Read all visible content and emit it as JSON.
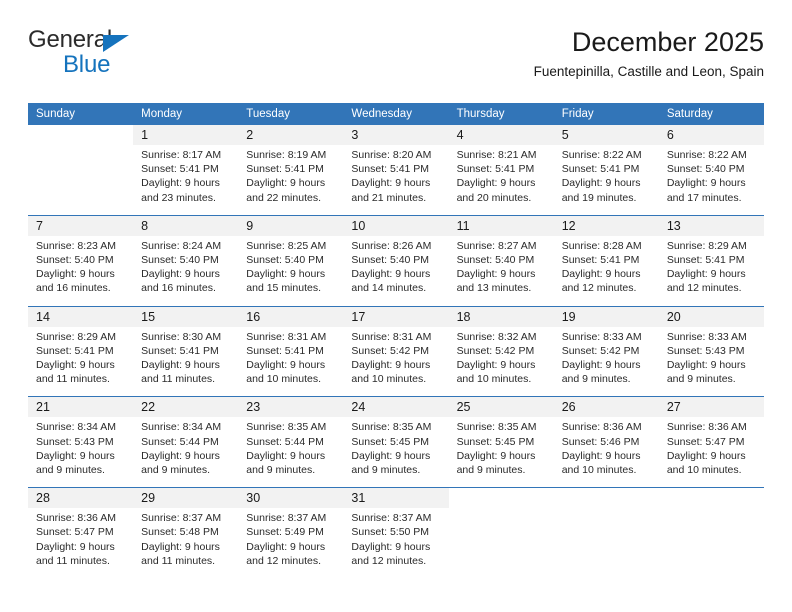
{
  "brand": {
    "name_top": "General",
    "name_bottom": "Blue",
    "triangle_color": "#1573bd",
    "text_color": "#2b2b2b"
  },
  "header": {
    "title": "December 2025",
    "subtitle": "Fuentepinilla, Castille and Leon, Spain"
  },
  "theme": {
    "header_blue": "#3275b8",
    "daynum_band": "#f2f2f2",
    "body_text": "#2a2a2a"
  },
  "calendar": {
    "weekday_headers": [
      "Sunday",
      "Monday",
      "Tuesday",
      "Wednesday",
      "Thursday",
      "Friday",
      "Saturday"
    ],
    "weeks": [
      [
        {
          "day": "",
          "sunrise": "",
          "sunset": "",
          "daylight_line1": "",
          "daylight_line2": ""
        },
        {
          "day": "1",
          "sunrise": "Sunrise: 8:17 AM",
          "sunset": "Sunset: 5:41 PM",
          "daylight_line1": "Daylight: 9 hours",
          "daylight_line2": "and 23 minutes."
        },
        {
          "day": "2",
          "sunrise": "Sunrise: 8:19 AM",
          "sunset": "Sunset: 5:41 PM",
          "daylight_line1": "Daylight: 9 hours",
          "daylight_line2": "and 22 minutes."
        },
        {
          "day": "3",
          "sunrise": "Sunrise: 8:20 AM",
          "sunset": "Sunset: 5:41 PM",
          "daylight_line1": "Daylight: 9 hours",
          "daylight_line2": "and 21 minutes."
        },
        {
          "day": "4",
          "sunrise": "Sunrise: 8:21 AM",
          "sunset": "Sunset: 5:41 PM",
          "daylight_line1": "Daylight: 9 hours",
          "daylight_line2": "and 20 minutes."
        },
        {
          "day": "5",
          "sunrise": "Sunrise: 8:22 AM",
          "sunset": "Sunset: 5:41 PM",
          "daylight_line1": "Daylight: 9 hours",
          "daylight_line2": "and 19 minutes."
        },
        {
          "day": "6",
          "sunrise": "Sunrise: 8:22 AM",
          "sunset": "Sunset: 5:40 PM",
          "daylight_line1": "Daylight: 9 hours",
          "daylight_line2": "and 17 minutes."
        }
      ],
      [
        {
          "day": "7",
          "sunrise": "Sunrise: 8:23 AM",
          "sunset": "Sunset: 5:40 PM",
          "daylight_line1": "Daylight: 9 hours",
          "daylight_line2": "and 16 minutes."
        },
        {
          "day": "8",
          "sunrise": "Sunrise: 8:24 AM",
          "sunset": "Sunset: 5:40 PM",
          "daylight_line1": "Daylight: 9 hours",
          "daylight_line2": "and 16 minutes."
        },
        {
          "day": "9",
          "sunrise": "Sunrise: 8:25 AM",
          "sunset": "Sunset: 5:40 PM",
          "daylight_line1": "Daylight: 9 hours",
          "daylight_line2": "and 15 minutes."
        },
        {
          "day": "10",
          "sunrise": "Sunrise: 8:26 AM",
          "sunset": "Sunset: 5:40 PM",
          "daylight_line1": "Daylight: 9 hours",
          "daylight_line2": "and 14 minutes."
        },
        {
          "day": "11",
          "sunrise": "Sunrise: 8:27 AM",
          "sunset": "Sunset: 5:40 PM",
          "daylight_line1": "Daylight: 9 hours",
          "daylight_line2": "and 13 minutes."
        },
        {
          "day": "12",
          "sunrise": "Sunrise: 8:28 AM",
          "sunset": "Sunset: 5:41 PM",
          "daylight_line1": "Daylight: 9 hours",
          "daylight_line2": "and 12 minutes."
        },
        {
          "day": "13",
          "sunrise": "Sunrise: 8:29 AM",
          "sunset": "Sunset: 5:41 PM",
          "daylight_line1": "Daylight: 9 hours",
          "daylight_line2": "and 12 minutes."
        }
      ],
      [
        {
          "day": "14",
          "sunrise": "Sunrise: 8:29 AM",
          "sunset": "Sunset: 5:41 PM",
          "daylight_line1": "Daylight: 9 hours",
          "daylight_line2": "and 11 minutes."
        },
        {
          "day": "15",
          "sunrise": "Sunrise: 8:30 AM",
          "sunset": "Sunset: 5:41 PM",
          "daylight_line1": "Daylight: 9 hours",
          "daylight_line2": "and 11 minutes."
        },
        {
          "day": "16",
          "sunrise": "Sunrise: 8:31 AM",
          "sunset": "Sunset: 5:41 PM",
          "daylight_line1": "Daylight: 9 hours",
          "daylight_line2": "and 10 minutes."
        },
        {
          "day": "17",
          "sunrise": "Sunrise: 8:31 AM",
          "sunset": "Sunset: 5:42 PM",
          "daylight_line1": "Daylight: 9 hours",
          "daylight_line2": "and 10 minutes."
        },
        {
          "day": "18",
          "sunrise": "Sunrise: 8:32 AM",
          "sunset": "Sunset: 5:42 PM",
          "daylight_line1": "Daylight: 9 hours",
          "daylight_line2": "and 10 minutes."
        },
        {
          "day": "19",
          "sunrise": "Sunrise: 8:33 AM",
          "sunset": "Sunset: 5:42 PM",
          "daylight_line1": "Daylight: 9 hours",
          "daylight_line2": "and 9 minutes."
        },
        {
          "day": "20",
          "sunrise": "Sunrise: 8:33 AM",
          "sunset": "Sunset: 5:43 PM",
          "daylight_line1": "Daylight: 9 hours",
          "daylight_line2": "and 9 minutes."
        }
      ],
      [
        {
          "day": "21",
          "sunrise": "Sunrise: 8:34 AM",
          "sunset": "Sunset: 5:43 PM",
          "daylight_line1": "Daylight: 9 hours",
          "daylight_line2": "and 9 minutes."
        },
        {
          "day": "22",
          "sunrise": "Sunrise: 8:34 AM",
          "sunset": "Sunset: 5:44 PM",
          "daylight_line1": "Daylight: 9 hours",
          "daylight_line2": "and 9 minutes."
        },
        {
          "day": "23",
          "sunrise": "Sunrise: 8:35 AM",
          "sunset": "Sunset: 5:44 PM",
          "daylight_line1": "Daylight: 9 hours",
          "daylight_line2": "and 9 minutes."
        },
        {
          "day": "24",
          "sunrise": "Sunrise: 8:35 AM",
          "sunset": "Sunset: 5:45 PM",
          "daylight_line1": "Daylight: 9 hours",
          "daylight_line2": "and 9 minutes."
        },
        {
          "day": "25",
          "sunrise": "Sunrise: 8:35 AM",
          "sunset": "Sunset: 5:45 PM",
          "daylight_line1": "Daylight: 9 hours",
          "daylight_line2": "and 9 minutes."
        },
        {
          "day": "26",
          "sunrise": "Sunrise: 8:36 AM",
          "sunset": "Sunset: 5:46 PM",
          "daylight_line1": "Daylight: 9 hours",
          "daylight_line2": "and 10 minutes."
        },
        {
          "day": "27",
          "sunrise": "Sunrise: 8:36 AM",
          "sunset": "Sunset: 5:47 PM",
          "daylight_line1": "Daylight: 9 hours",
          "daylight_line2": "and 10 minutes."
        }
      ],
      [
        {
          "day": "28",
          "sunrise": "Sunrise: 8:36 AM",
          "sunset": "Sunset: 5:47 PM",
          "daylight_line1": "Daylight: 9 hours",
          "daylight_line2": "and 11 minutes."
        },
        {
          "day": "29",
          "sunrise": "Sunrise: 8:37 AM",
          "sunset": "Sunset: 5:48 PM",
          "daylight_line1": "Daylight: 9 hours",
          "daylight_line2": "and 11 minutes."
        },
        {
          "day": "30",
          "sunrise": "Sunrise: 8:37 AM",
          "sunset": "Sunset: 5:49 PM",
          "daylight_line1": "Daylight: 9 hours",
          "daylight_line2": "and 12 minutes."
        },
        {
          "day": "31",
          "sunrise": "Sunrise: 8:37 AM",
          "sunset": "Sunset: 5:50 PM",
          "daylight_line1": "Daylight: 9 hours",
          "daylight_line2": "and 12 minutes."
        },
        {
          "day": "",
          "sunrise": "",
          "sunset": "",
          "daylight_line1": "",
          "daylight_line2": ""
        },
        {
          "day": "",
          "sunrise": "",
          "sunset": "",
          "daylight_line1": "",
          "daylight_line2": ""
        },
        {
          "day": "",
          "sunrise": "",
          "sunset": "",
          "daylight_line1": "",
          "daylight_line2": ""
        }
      ]
    ]
  }
}
